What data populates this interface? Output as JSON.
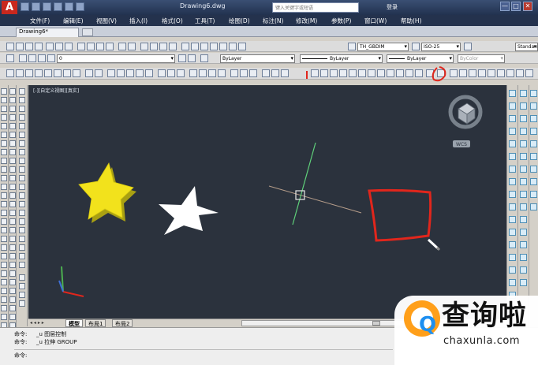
{
  "app": {
    "title": "Drawing6.dwg",
    "icon": "autocad-logo-icon",
    "help_search_placeholder": "键入关键字或短语",
    "login": "登录",
    "window_controls": [
      "—",
      "□",
      "✕"
    ]
  },
  "menu": {
    "items": [
      "文件(F)",
      "编辑(E)",
      "视图(V)",
      "插入(I)",
      "格式(O)",
      "工具(T)",
      "绘图(D)",
      "标注(N)",
      "修改(M)",
      "参数(P)",
      "窗口(W)",
      "帮助(H)"
    ]
  },
  "document_tabs": [
    {
      "label": "Drawing6*",
      "active": true
    }
  ],
  "toolbars": {
    "text_style": "TH_GBDIM",
    "dim_style": "ISO-25",
    "layer": "0",
    "named_style": "Standard",
    "color": "ByLayer",
    "linetype": "ByLayer",
    "lineweight": "ByLayer",
    "plot_style": "ByColor",
    "highlighted_tool": "rectangle-tool-icon"
  },
  "viewport": {
    "label": "[-][自定义视图][真实]",
    "viewcube_label": "WCS",
    "background": "#2b323d",
    "objects": [
      "3d-star-yellow",
      "star-white",
      "crosshair-cursor",
      "rectangle-red",
      "ucs-icon"
    ]
  },
  "layout_tabs": [
    {
      "label": "模型",
      "active": true
    },
    {
      "label": "布局1",
      "active": false
    },
    {
      "label": "布局2",
      "active": false
    }
  ],
  "command_history": [
    {
      "prompt": "命令:",
      "text": "_u 图层控制"
    },
    {
      "prompt": "命令:",
      "text": "_u 拉伸 GROUP"
    }
  ],
  "command_prompt": "命令:",
  "watermark": {
    "brand": "查询啦",
    "domain": "chaxunla.com",
    "logo_letter": "Q"
  },
  "colors": {
    "accent_red": "#e1261c",
    "star_yellow": "#f2e21c",
    "watermark_orange": "#ff9f1a",
    "watermark_blue": "#1d8ff0"
  }
}
